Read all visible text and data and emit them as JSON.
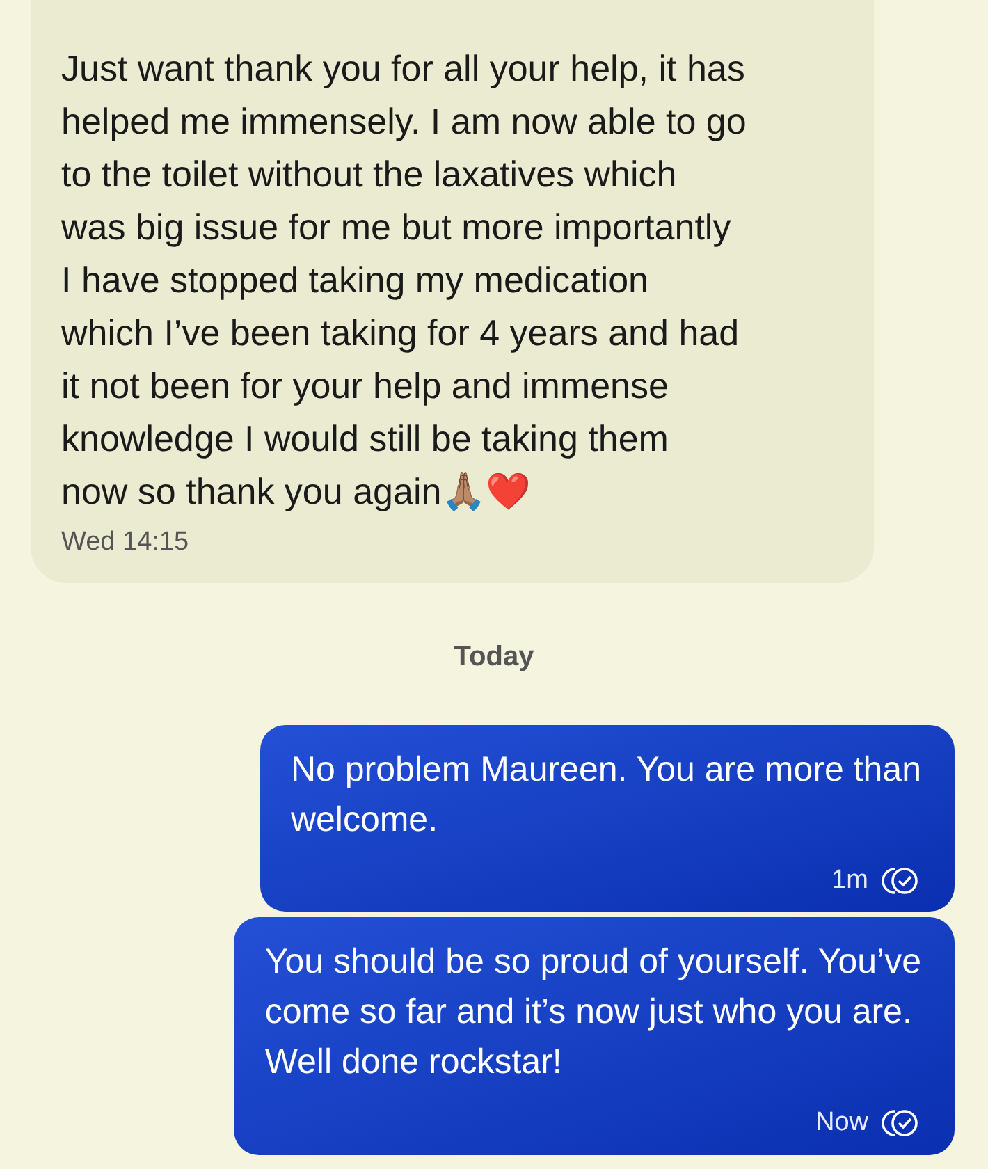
{
  "messages": [
    {
      "kind": "incoming",
      "text": "Just want thank you for all your help, it has\nhelped me immensely. I am now able to go\nto the toilet without the laxatives which\nwas big issue for me but more importantly\nI have stopped taking my medication\nwhich I’ve been taking for 4 years and had\nit not been for your help and immense\nknowledge I would still be taking them\nnow so thank you again🙏🏽❤️",
      "time": "Wed 14:15",
      "read": false
    },
    {
      "kind": "divider",
      "text": "Today"
    },
    {
      "kind": "outgoing",
      "text": "No problem Maureen. You are more than\nwelcome.",
      "time": "1m",
      "read": true
    },
    {
      "kind": "outgoing",
      "text": "You should be so proud of yourself. You’ve\ncome so far and it’s now just who you are.\nWell done rockstar!",
      "time": "Now",
      "read": true
    }
  ]
}
